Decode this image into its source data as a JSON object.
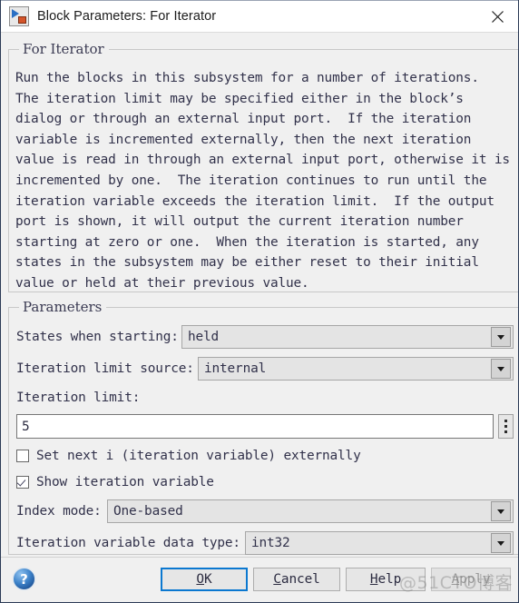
{
  "window": {
    "title": "Block Parameters: For Iterator",
    "icon": "simulink-block-icon",
    "close_label": "✕"
  },
  "description_group": {
    "legend": "For Iterator",
    "text": "Run the blocks in this subsystem for a number of iterations.\nThe iteration limit may be specified either in the block’s\ndialog or through an external input port.  If the iteration\nvariable is incremented externally, then the next iteration\nvalue is read in through an external input port, otherwise it is\nincremented by one.  The iteration continues to run until the\niteration variable exceeds the iteration limit.  If the output\nport is shown, it will output the current iteration number\nstarting at zero or one.  When the iteration is started, any\nstates in the subsystem may be either reset to their initial\nvalue or held at their previous value."
  },
  "parameters_group": {
    "legend": "Parameters",
    "states_when_starting": {
      "label": "States when starting:",
      "value": "held"
    },
    "iteration_limit_source": {
      "label": "Iteration limit source:",
      "value": "internal"
    },
    "iteration_limit": {
      "label": "Iteration limit:",
      "value": "5",
      "spinner": "vertical-dots"
    },
    "set_next_i": {
      "label": "Set next i (iteration variable) externally",
      "checked": false
    },
    "show_iteration_variable": {
      "label": "Show iteration variable",
      "checked": true
    },
    "index_mode": {
      "label": "Index mode:",
      "value": "One-based"
    },
    "iteration_variable_data_type": {
      "label": "Iteration variable data type:",
      "value": "int32"
    }
  },
  "footer": {
    "help_icon": "help-question-icon",
    "buttons": [
      {
        "label": "OK",
        "mnemonic": "O",
        "state": "default"
      },
      {
        "label": "Cancel",
        "mnemonic": "C",
        "state": "normal"
      },
      {
        "label": "Help",
        "mnemonic": "H",
        "state": "normal"
      },
      {
        "label": "Apply",
        "mnemonic": "A",
        "state": "disabled"
      }
    ],
    "watermark": "@51CTO博客"
  },
  "colors": {
    "accent": "#0b78d0",
    "dialog_bg": "#f0f0f0",
    "text": "#31314a",
    "window_border": "#2b3a55"
  }
}
